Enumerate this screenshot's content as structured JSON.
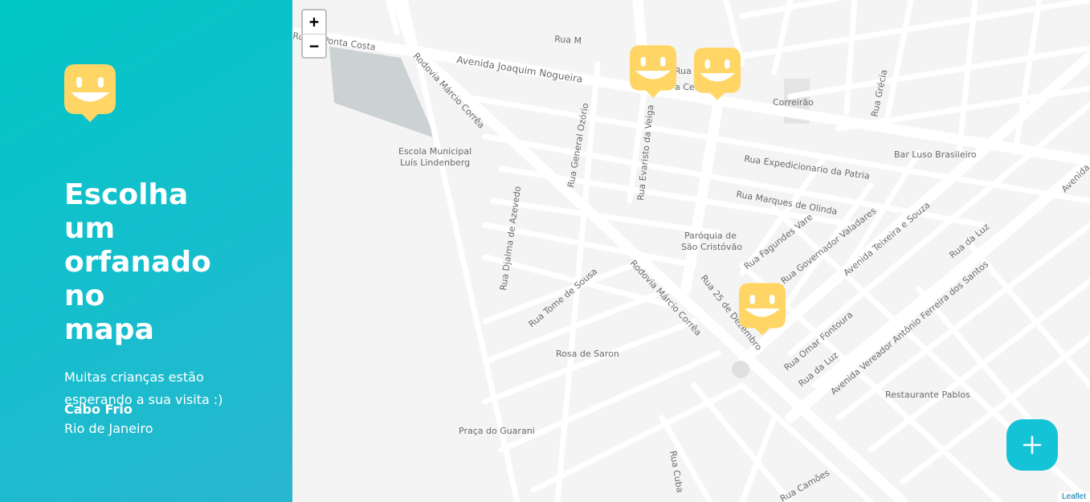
{
  "sidebar": {
    "title": "Escolha um orfanado no mapa",
    "description": "Muitas crianças estão esperando a sua visita :)",
    "city": "Cabo Frio",
    "state": "Rio de Janeiro"
  },
  "map": {
    "zoom_in": "+",
    "zoom_out": "−",
    "attribution": "Leaflet",
    "labels": {
      "ponta_costa": "Rua S. Ponta Costa",
      "rua_m": "Rua M",
      "joaquim": "Avenida Joaquim Nogueira",
      "rodovia1": "Rodovia Márcio Corrêa",
      "rodovia2": "Rodovia Márcio Corrêa",
      "escola": "Escola Municipal",
      "escola2": "Luís Lindenberg",
      "ozorio": "Rua General Ozório",
      "evaristo": "Rua Evaristo da Veiga",
      "djalma": "Rua Djalma de Azevedo",
      "correirao": "Correirão",
      "grecia": "Rua Grécia",
      "bar": "Bar Luso Brasileiro",
      "expedicionario": "Rua Expedicionario da Patria",
      "marques": "Rua Marques de Olinda",
      "paroquia": "Paróquia de",
      "paroquia2": "São Cristóvão",
      "fagundes": "Rua Fagundes Vare",
      "valadares": "Rua Governador Valadares",
      "teixeira": "Avenida Teixeira e Souza",
      "luz1": "Rua da Luz",
      "ferreira": "Avenida Vereador Antônio Ferreira dos Santos",
      "tome": "Rua Tome de Sousa",
      "rosa": "Rosa de Saron",
      "dezembro": "Rua 25 de Dezembro",
      "omar": "Rua Omar Fontoura",
      "luz2": "Rua da Luz",
      "pablos": "Restaurante Pablos",
      "guarani": "Praça do Guarani",
      "cuba": "Rua Cuba",
      "camoes": "Rua Camões",
      "avenida_right": "Avenida",
      "rua_fe": "Rua F",
      "rua_ce": "a Ceci"
    }
  },
  "colors": {
    "sidebar_gradient_start": "#00c7c7",
    "sidebar_gradient_end": "#29b6d1",
    "marker": "#ffd666",
    "fab": "#15c3d6"
  },
  "icons": {
    "logo": "smile-marker-icon",
    "marker": "smile-marker-icon",
    "fab": "plus-icon"
  }
}
